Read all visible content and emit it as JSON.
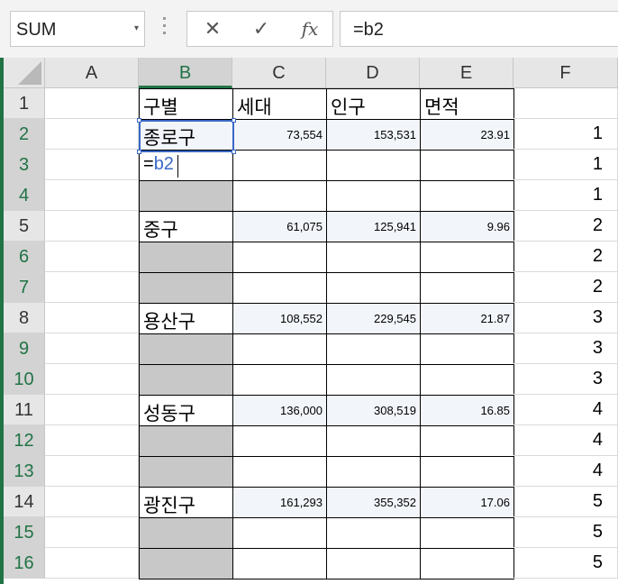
{
  "namebox": {
    "value": "SUM",
    "arrow": "▾"
  },
  "formula_bar": {
    "cancel": "✕",
    "enter": "✓",
    "fx": "fx",
    "value": "=b2"
  },
  "columns": [
    "A",
    "B",
    "C",
    "D",
    "E",
    "F"
  ],
  "rows": [
    "1",
    "2",
    "3",
    "4",
    "5",
    "6",
    "7",
    "8",
    "9",
    "10",
    "11",
    "12",
    "13",
    "14",
    "15",
    "16"
  ],
  "cells": {
    "B1": "구별",
    "C1": "세대",
    "D1": "인구",
    "E1": "면적",
    "B2": "종로구",
    "C2": "73,554",
    "D2": "153,531",
    "E2": "23.91",
    "F2": "1",
    "B3_prefix": "=",
    "B3_ref": "b2",
    "F3": "1",
    "F4": "1",
    "B5": "중구",
    "C5": "61,075",
    "D5": "125,941",
    "E5": "9.96",
    "F5": "2",
    "F6": "2",
    "F7": "2",
    "B8": "용산구",
    "C8": "108,552",
    "D8": "229,545",
    "E8": "21.87",
    "F8": "3",
    "F9": "3",
    "F10": "3",
    "B11": "성동구",
    "C11": "136,000",
    "D11": "308,519",
    "E11": "16.85",
    "F11": "4",
    "F12": "4",
    "F13": "4",
    "B14": "광진구",
    "C14": "161,293",
    "D14": "355,352",
    "E14": "17.06",
    "F14": "5",
    "F15": "5",
    "F16": "5"
  },
  "colors": {
    "accent_green": "#217346",
    "selection_blue": "#3a68c4",
    "gray_fill": "#c8c8c8"
  }
}
